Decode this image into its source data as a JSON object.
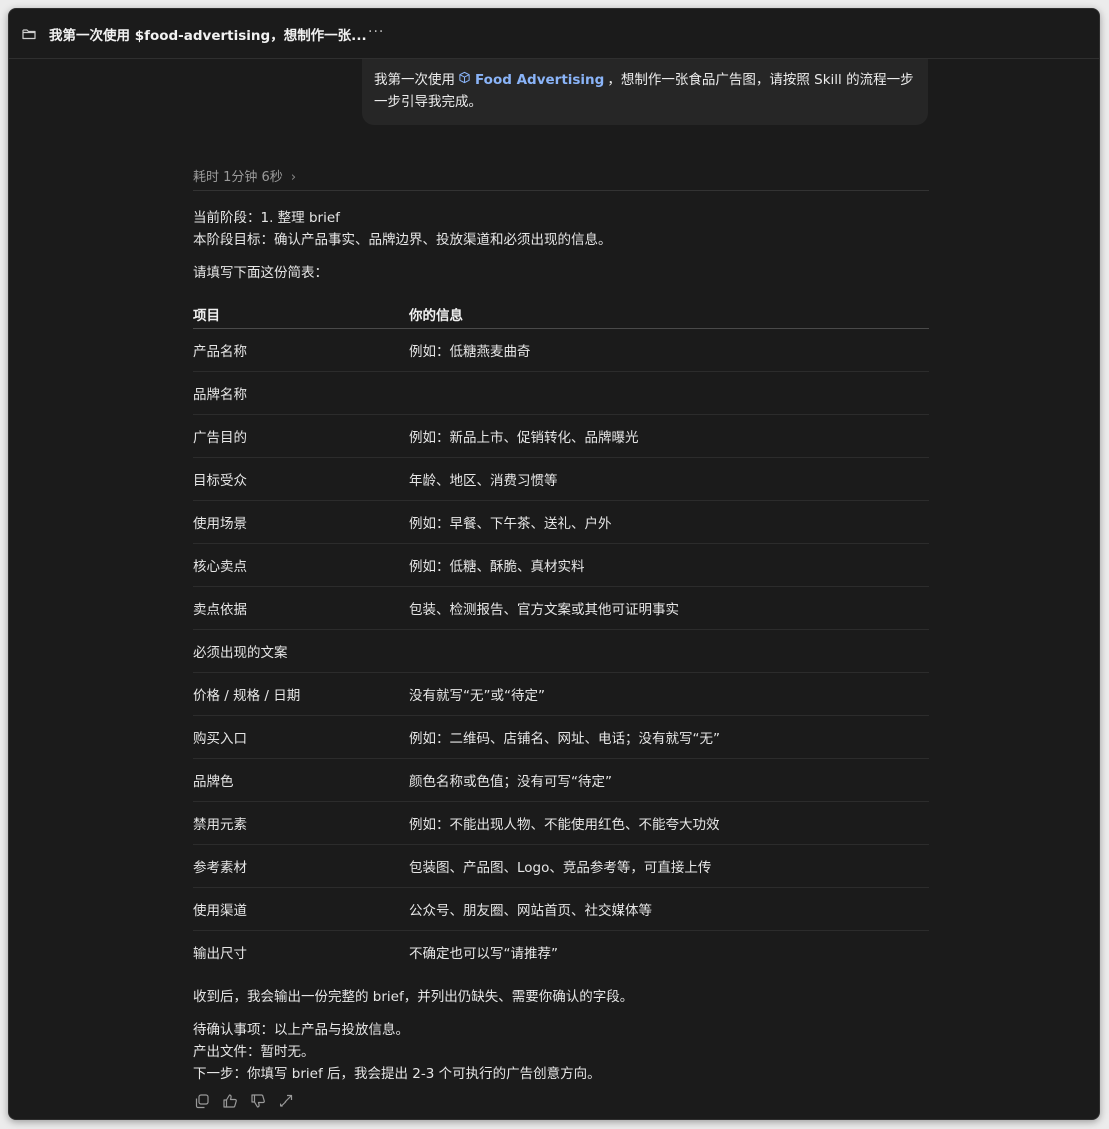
{
  "titlebar": {
    "title": "我第一次使用 $food-advertising，想制作一张...",
    "more_label": "···"
  },
  "user_message": {
    "before": "我第一次使用",
    "skill_name": "Food Advertising",
    "after": "，想制作一张食品广告图，请按照 Skill 的流程一步一步引导我完成。"
  },
  "response": {
    "elapsed": "耗时 1分钟 6秒",
    "stage": "当前阶段：1. 整理 brief",
    "goal": "本阶段目标：确认产品事实、品牌边界、投放渠道和必须出现的信息。",
    "prompt": "请填写下面这份简表：",
    "table": {
      "headers": [
        "项目",
        "你的信息"
      ],
      "rows": [
        [
          "产品名称",
          "例如：低糖燕麦曲奇"
        ],
        [
          "品牌名称",
          ""
        ],
        [
          "广告目的",
          "例如：新品上市、促销转化、品牌曝光"
        ],
        [
          "目标受众",
          "年龄、地区、消费习惯等"
        ],
        [
          "使用场景",
          "例如：早餐、下午茶、送礼、户外"
        ],
        [
          "核心卖点",
          "例如：低糖、酥脆、真材实料"
        ],
        [
          "卖点依据",
          "包装、检测报告、官方文案或其他可证明事实"
        ],
        [
          "必须出现的文案",
          ""
        ],
        [
          "价格 / 规格 / 日期",
          "没有就写“无”或“待定”"
        ],
        [
          "购买入口",
          "例如：二维码、店铺名、网址、电话；没有就写“无”"
        ],
        [
          "品牌色",
          "颜色名称或色值；没有可写“待定”"
        ],
        [
          "禁用元素",
          "例如：不能出现人物、不能使用红色、不能夸大功效"
        ],
        [
          "参考素材",
          "包装图、产品图、Logo、竞品参考等，可直接上传"
        ],
        [
          "使用渠道",
          "公众号、朋友圈、网站首页、社交媒体等"
        ],
        [
          "输出尺寸",
          "不确定也可以写“请推荐”"
        ]
      ]
    },
    "after_table": "收到后，我会输出一份完整的 brief，并列出仍缺失、需要你确认的字段。",
    "pending": "待确认事项：以上产品与投放信息。",
    "output_files": "产出文件：暂时无。",
    "next_step": "下一步：你填写 brief 后，我会提出 2-3 个可执行的广告创意方向。"
  },
  "icons": {
    "title_icon": "folder-icon",
    "skill_icon": "cube-icon",
    "actions": [
      "copy-icon",
      "thumbs-up-icon",
      "thumbs-down-icon",
      "share-icon"
    ]
  },
  "colors": {
    "background": "#1b1b1b",
    "bubble": "#262626",
    "link": "#8ab4f8"
  }
}
